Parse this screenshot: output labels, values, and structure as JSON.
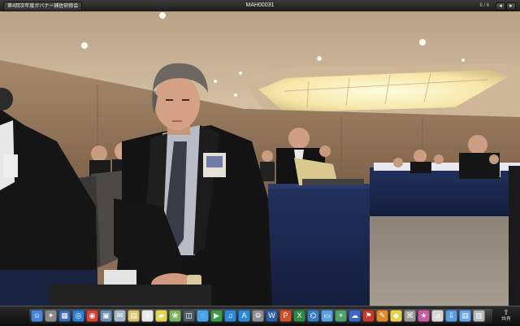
{
  "window": {
    "folder_tag": "第4回次年度ガバナー補佐研修会",
    "title": "MAH00031",
    "counter": "6 / 6",
    "prev_label": "◂",
    "next_label": "▸"
  },
  "photo": {
    "description_colors": {
      "wall": "#9b7b5f",
      "ceiling": "#c9b49a",
      "light_panel": "#fff6c8",
      "tablecloth": "#1c2a52",
      "carpet": "#9a8f84",
      "suit": "#141414"
    }
  },
  "dock": {
    "icons": [
      {
        "name": "finder-icon",
        "color": "#4a86d6",
        "glyph": "☺"
      },
      {
        "name": "launchpad-icon",
        "color": "#8a8a8a",
        "glyph": "✦"
      },
      {
        "name": "mission-control-icon",
        "color": "#3b6db0",
        "glyph": "▦"
      },
      {
        "name": "safari-icon",
        "color": "#2f7fd8",
        "glyph": "◎"
      },
      {
        "name": "chrome-icon",
        "color": "#d8443a",
        "glyph": "◉"
      },
      {
        "name": "preview-icon",
        "color": "#6b8fb5",
        "glyph": "▣"
      },
      {
        "name": "mail-icon",
        "color": "#a5b7c9",
        "glyph": "✉"
      },
      {
        "name": "notes-icon",
        "color": "#d7c56a",
        "glyph": "▤"
      },
      {
        "name": "calendar-icon",
        "color": "#e9e9e9",
        "glyph": "6"
      },
      {
        "name": "stickies-icon",
        "color": "#e6d35b",
        "glyph": "▰"
      },
      {
        "name": "photos-icon",
        "color": "#7bb55c",
        "glyph": "❀"
      },
      {
        "name": "image-capture-icon",
        "color": "#505c66",
        "glyph": "◫"
      },
      {
        "name": "messages-icon",
        "color": "#4aa3e8",
        "glyph": "◌"
      },
      {
        "name": "facetime-icon",
        "color": "#3d9b4a",
        "glyph": "▶"
      },
      {
        "name": "itunes-icon",
        "color": "#2f89d9",
        "glyph": "♫"
      },
      {
        "name": "app-store-icon",
        "color": "#2a8ae0",
        "glyph": "A"
      },
      {
        "name": "system-preferences-icon",
        "color": "#8e8e93",
        "glyph": "⚙"
      },
      {
        "name": "word-icon",
        "color": "#2f5fa8",
        "glyph": "W"
      },
      {
        "name": "powerpoint-icon",
        "color": "#d0532b",
        "glyph": "P"
      },
      {
        "name": "excel-icon",
        "color": "#2f8a4a",
        "glyph": "X"
      },
      {
        "name": "network-icon",
        "color": "#3a7cc4",
        "glyph": "⌬"
      },
      {
        "name": "folder-icon",
        "color": "#5aa0e6",
        "glyph": "▭"
      },
      {
        "name": "map-icon",
        "color": "#4fa06a",
        "glyph": "⌖"
      },
      {
        "name": "messenger-icon",
        "color": "#3b68c9",
        "glyph": "☁"
      },
      {
        "name": "acrobat-icon",
        "color": "#c73a2e",
        "glyph": "⚑"
      },
      {
        "name": "pages-icon",
        "color": "#e08a2c",
        "glyph": "✎"
      },
      {
        "name": "keynote-icon",
        "color": "#e9d14a",
        "glyph": "◆"
      },
      {
        "name": "utility-icon",
        "color": "#9a9a9a",
        "glyph": "⌘"
      },
      {
        "name": "itunes-store-icon",
        "color": "#c85aa8",
        "glyph": "★"
      },
      {
        "name": "grapher-icon",
        "color": "#d9d9d9",
        "glyph": "⊿"
      },
      {
        "name": "downloads-folder-icon",
        "color": "#5b9ce4",
        "glyph": "⇩"
      },
      {
        "name": "documents-folder-icon",
        "color": "#6aa6e8",
        "glyph": "▤"
      },
      {
        "name": "trash-icon",
        "color": "#b8b8b8",
        "glyph": "▥"
      }
    ],
    "share_glyph": "⇪",
    "share_label": "共有"
  }
}
